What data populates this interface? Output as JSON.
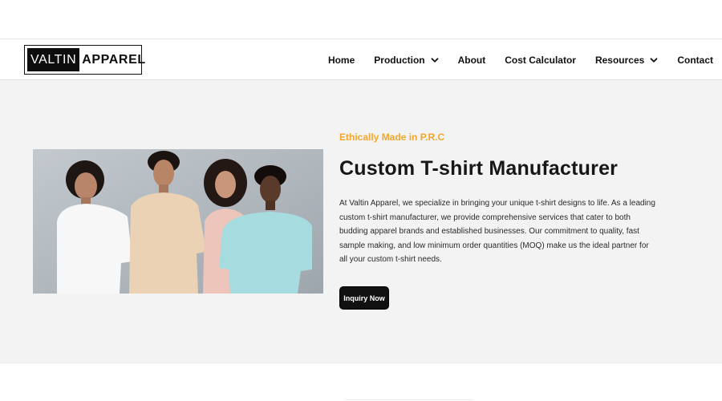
{
  "header": {
    "logo": {
      "part1": "VALTIN",
      "part2": "APPAREL"
    },
    "nav": [
      {
        "label": "Home",
        "has_dropdown": false
      },
      {
        "label": "Production",
        "has_dropdown": true
      },
      {
        "label": "About",
        "has_dropdown": false
      },
      {
        "label": "Cost Calculator",
        "has_dropdown": false
      },
      {
        "label": "Resources",
        "has_dropdown": true
      },
      {
        "label": "Contact",
        "has_dropdown": false
      }
    ]
  },
  "hero": {
    "eyebrow": "Ethically Made in P.R.C",
    "title": "Custom T-shirt Manufacturer",
    "body": "At Valtin Apparel, we specialize in bringing your unique t-shirt designs to life. As a leading custom t-shirt manufacturer, we provide comprehensive services that cater to both budding apparel brands and established businesses. Our commitment to quality, fast sample making, and low minimum order quantities (MOQ) make us the ideal partner for all your custom t-shirt needs.",
    "cta_label": "Inquiry Now"
  },
  "colors": {
    "accent": "#f2a72a",
    "hero_bg": "#f3f3f3",
    "button_bg": "#111111",
    "text": "#171717"
  },
  "icons": {
    "dropdown": "chevron-down-icon"
  }
}
